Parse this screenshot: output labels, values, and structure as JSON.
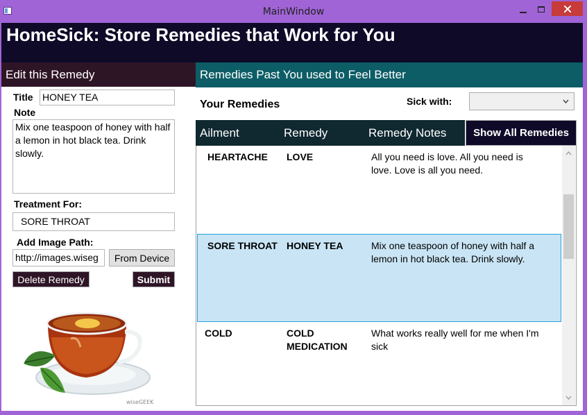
{
  "window": {
    "title": "MainWindow"
  },
  "app": {
    "title": "HomeSick: Store Remedies that Work for You"
  },
  "edit": {
    "header": "Edit this Remedy",
    "title_label": "Title",
    "title_value": "HONEY TEA",
    "note_label": "Note",
    "note_value": "Mix one teaspoon of honey with half a lemon in hot black tea. Drink slowly.",
    "treatment_label": "Treatment For:",
    "treatment_value": "SORE THROAT",
    "image_label": "Add Image Path:",
    "image_value": "http://images.wiseg",
    "from_device_label": "From Device",
    "delete_label": "Delete Remedy",
    "submit_label": "Submit",
    "image_watermark": "wiseGEEK"
  },
  "remedies": {
    "header": "Remedies Past You used to Feel Better",
    "your_remedies_label": "Your Remedies",
    "sick_with_label": "Sick with:",
    "sick_with_value": "",
    "columns": {
      "ailment": "Ailment",
      "remedy": "Remedy",
      "notes": "Remedy Notes"
    },
    "show_all_label": "Show All Remedies",
    "rows": [
      {
        "ailment": "HEARTACHE",
        "remedy": "LOVE",
        "notes": "All you need is love. All you need is love. Love is all you need.",
        "selected": false
      },
      {
        "ailment": "SORE THROAT",
        "remedy": "HONEY TEA",
        "notes": "Mix one teaspoon of honey with half a lemon in hot black tea. Drink slowly.",
        "selected": true
      },
      {
        "ailment": "COLD",
        "remedy": "COLD MEDICATION",
        "notes": "What works really well for me when I'm sick",
        "selected": false
      }
    ]
  },
  "colors": {
    "frame": "#a064d6",
    "header_bg": "#0e0a28",
    "edit_header_bg": "#2e1526",
    "remedies_header_bg": "#0d5d66",
    "selection_bg": "#c9e5f5",
    "selection_border": "#26a0da"
  }
}
